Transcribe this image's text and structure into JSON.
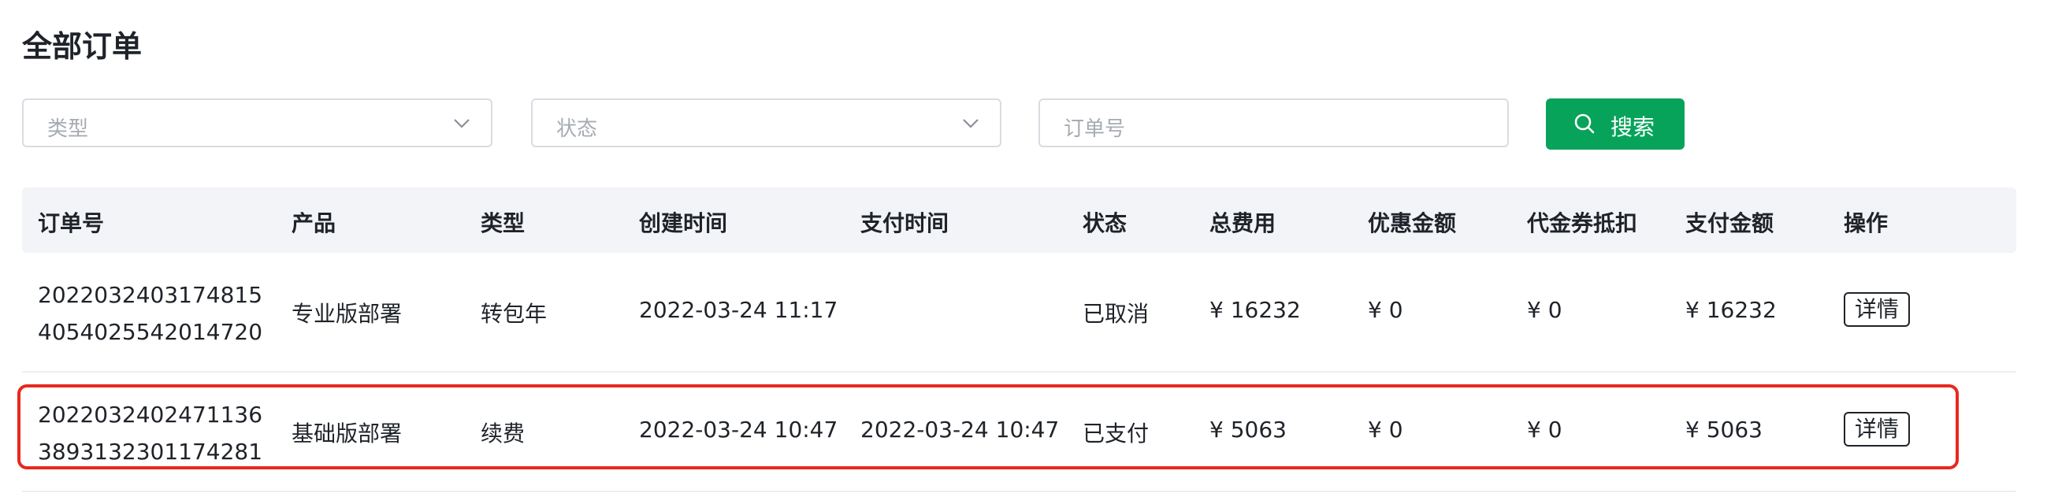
{
  "page": {
    "title": "全部订单"
  },
  "filters": {
    "type_placeholder": "类型",
    "status_placeholder": "状态",
    "order_placeholder": "订单号",
    "search_label": "搜索"
  },
  "table": {
    "headers": [
      "订单号",
      "产品",
      "类型",
      "创建时间",
      "支付时间",
      "状态",
      "总费用",
      "优惠金额",
      "代金券抵扣",
      "支付金额",
      "操作"
    ],
    "rows": [
      {
        "order_no": "20220324031748154054025542014720",
        "product": "专业版部署",
        "type": "转包年",
        "created": "2022-03-24 11:17",
        "paid_time": "",
        "status": "已取消",
        "total": "¥ 16232",
        "discount": "¥ 0",
        "voucher": "¥ 0",
        "pay_amount": "¥ 16232",
        "action": "详情"
      },
      {
        "order_no": "20220324024711363893132301174281",
        "product": "基础版部署",
        "type": "续费",
        "created": "2022-03-24 10:47",
        "paid_time": "2022-03-24 10:47",
        "status": "已支付",
        "total": "¥ 5063",
        "discount": "¥ 0",
        "voucher": "¥ 0",
        "pay_amount": "¥ 5063",
        "action": "详情"
      }
    ]
  },
  "colors": {
    "accent": "#07a35a",
    "highlight": "#e8281f",
    "header_bg": "#f2f4f7"
  },
  "icons": {
    "dropdown": "chevron-down-icon",
    "search": "search-icon"
  }
}
